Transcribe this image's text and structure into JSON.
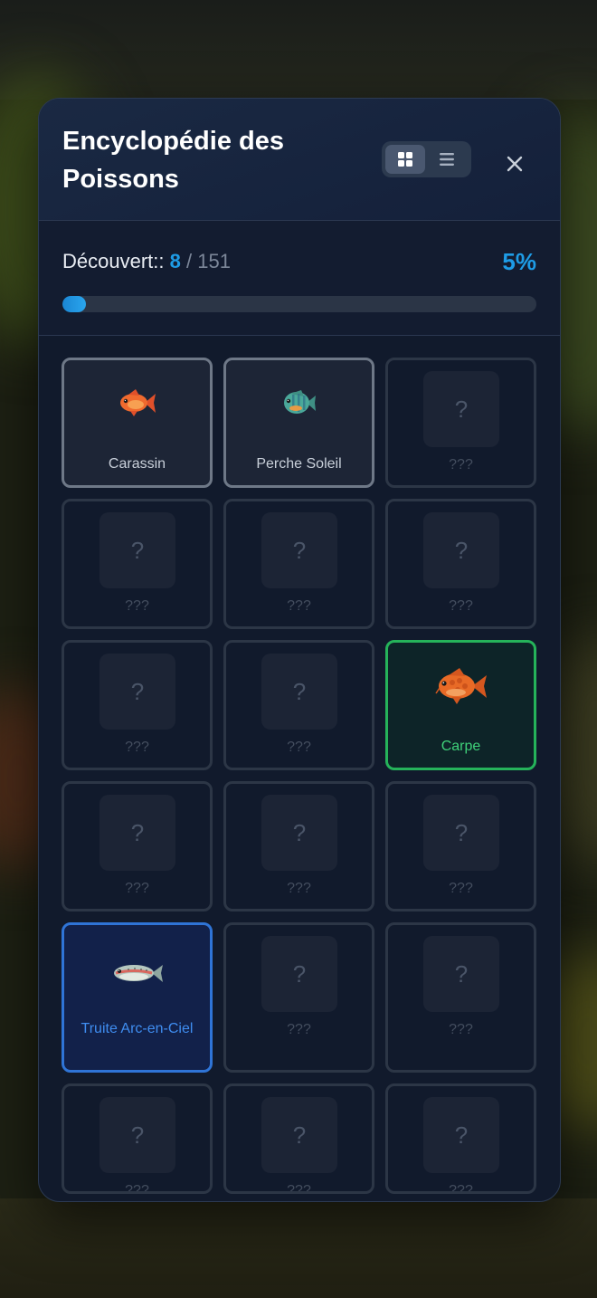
{
  "modal": {
    "title": "Encyclopédie des Poissons",
    "view_grid_icon": "grid-icon",
    "view_list_icon": "list-icon",
    "close_icon": "close-icon"
  },
  "progress": {
    "label": "Découvert::",
    "discovered": "8",
    "separator": "/",
    "total": "151",
    "percent_text": "5%",
    "fraction": 0.05
  },
  "fish_cards": [
    {
      "name": "Carassin",
      "status": "discovered",
      "icon": "goldfish-icon"
    },
    {
      "name": "Perche Soleil",
      "status": "discovered",
      "icon": "sunfish-icon"
    },
    {
      "name": "???",
      "status": "unknown",
      "icon": "question-icon"
    },
    {
      "name": "???",
      "status": "unknown",
      "icon": "question-icon"
    },
    {
      "name": "???",
      "status": "unknown",
      "icon": "question-icon"
    },
    {
      "name": "???",
      "status": "unknown",
      "icon": "question-icon"
    },
    {
      "name": "???",
      "status": "unknown",
      "icon": "question-icon"
    },
    {
      "name": "???",
      "status": "unknown",
      "icon": "question-icon"
    },
    {
      "name": "Carpe",
      "status": "discovered",
      "icon": "carp-icon"
    },
    {
      "name": "???",
      "status": "unknown",
      "icon": "question-icon"
    },
    {
      "name": "???",
      "status": "unknown",
      "icon": "question-icon"
    },
    {
      "name": "???",
      "status": "unknown",
      "icon": "question-icon"
    },
    {
      "name": "Truite Arc-en-Ciel",
      "status": "discovered",
      "icon": "trout-icon"
    },
    {
      "name": "???",
      "status": "unknown",
      "icon": "question-icon"
    },
    {
      "name": "???",
      "status": "unknown",
      "icon": "question-icon"
    },
    {
      "name": "???",
      "status": "unknown",
      "icon": "question-icon"
    },
    {
      "name": "???",
      "status": "unknown",
      "icon": "question-icon"
    },
    {
      "name": "???",
      "status": "unknown",
      "icon": "question-icon"
    }
  ],
  "placeholder_glyph": "?",
  "colors": {
    "accent": "#1e9ce6",
    "card_grey_border": "#6e7887",
    "card_green_border": "#25b35a",
    "card_blue_border": "#2f74d6"
  }
}
